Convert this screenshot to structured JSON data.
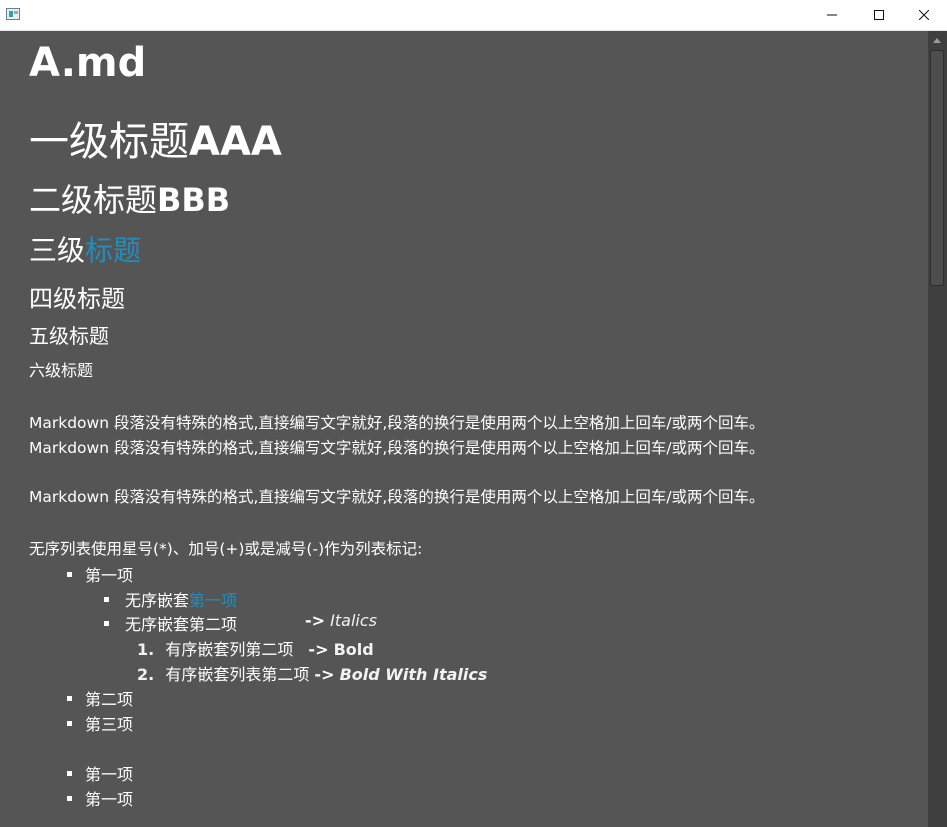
{
  "window": {
    "minimize_glyph": "—",
    "maximize_glyph": "☐",
    "close_glyph": "✕"
  },
  "doc": {
    "file_title": "A.md",
    "h1_text": "一级标题",
    "h1_bold": "AAA",
    "h2_text": "二级标题",
    "h2_bold": "BBB",
    "h3_text": "三级",
    "h3_link": "标题",
    "h4": "四级标题",
    "h5": "五级标题",
    "h6": "六级标题",
    "para1": "Markdown 段落没有特殊的格式,直接编写文字就好,段落的换行是使用两个以上空格加上回车/或两个回车。",
    "para2": "Markdown 段落没有特殊的格式,直接编写文字就好,段落的换行是使用两个以上空格加上回车/或两个回车。",
    "para3": "Markdown 段落没有特殊的格式,直接编写文字就好,段落的换行是使用两个以上空格加上回车/或两个回车。",
    "list_intro": "无序列表使用星号(*)、加号(+)或是减号(-)作为列表标记:",
    "list1": {
      "item1": "第一项",
      "nested1_text": "无序嵌套",
      "nested1_link": "第一项",
      "nested2_text": "无序嵌套第二项",
      "nested2_arrow": "->",
      "nested2_italic": "Italics",
      "ol1_num": "1.",
      "ol1_text": "有序嵌套列第二项",
      "ol1_arrow": "->",
      "ol1_bold": "Bold",
      "ol2_num": "2.",
      "ol2_text": "有序嵌套列表第二项",
      "ol2_arrow": "->",
      "ol2_bolditalic": "Bold With Italics",
      "item2": "第二项",
      "item3": "第三项"
    },
    "list2": {
      "item1": "第一项",
      "item2": "第一项"
    }
  }
}
